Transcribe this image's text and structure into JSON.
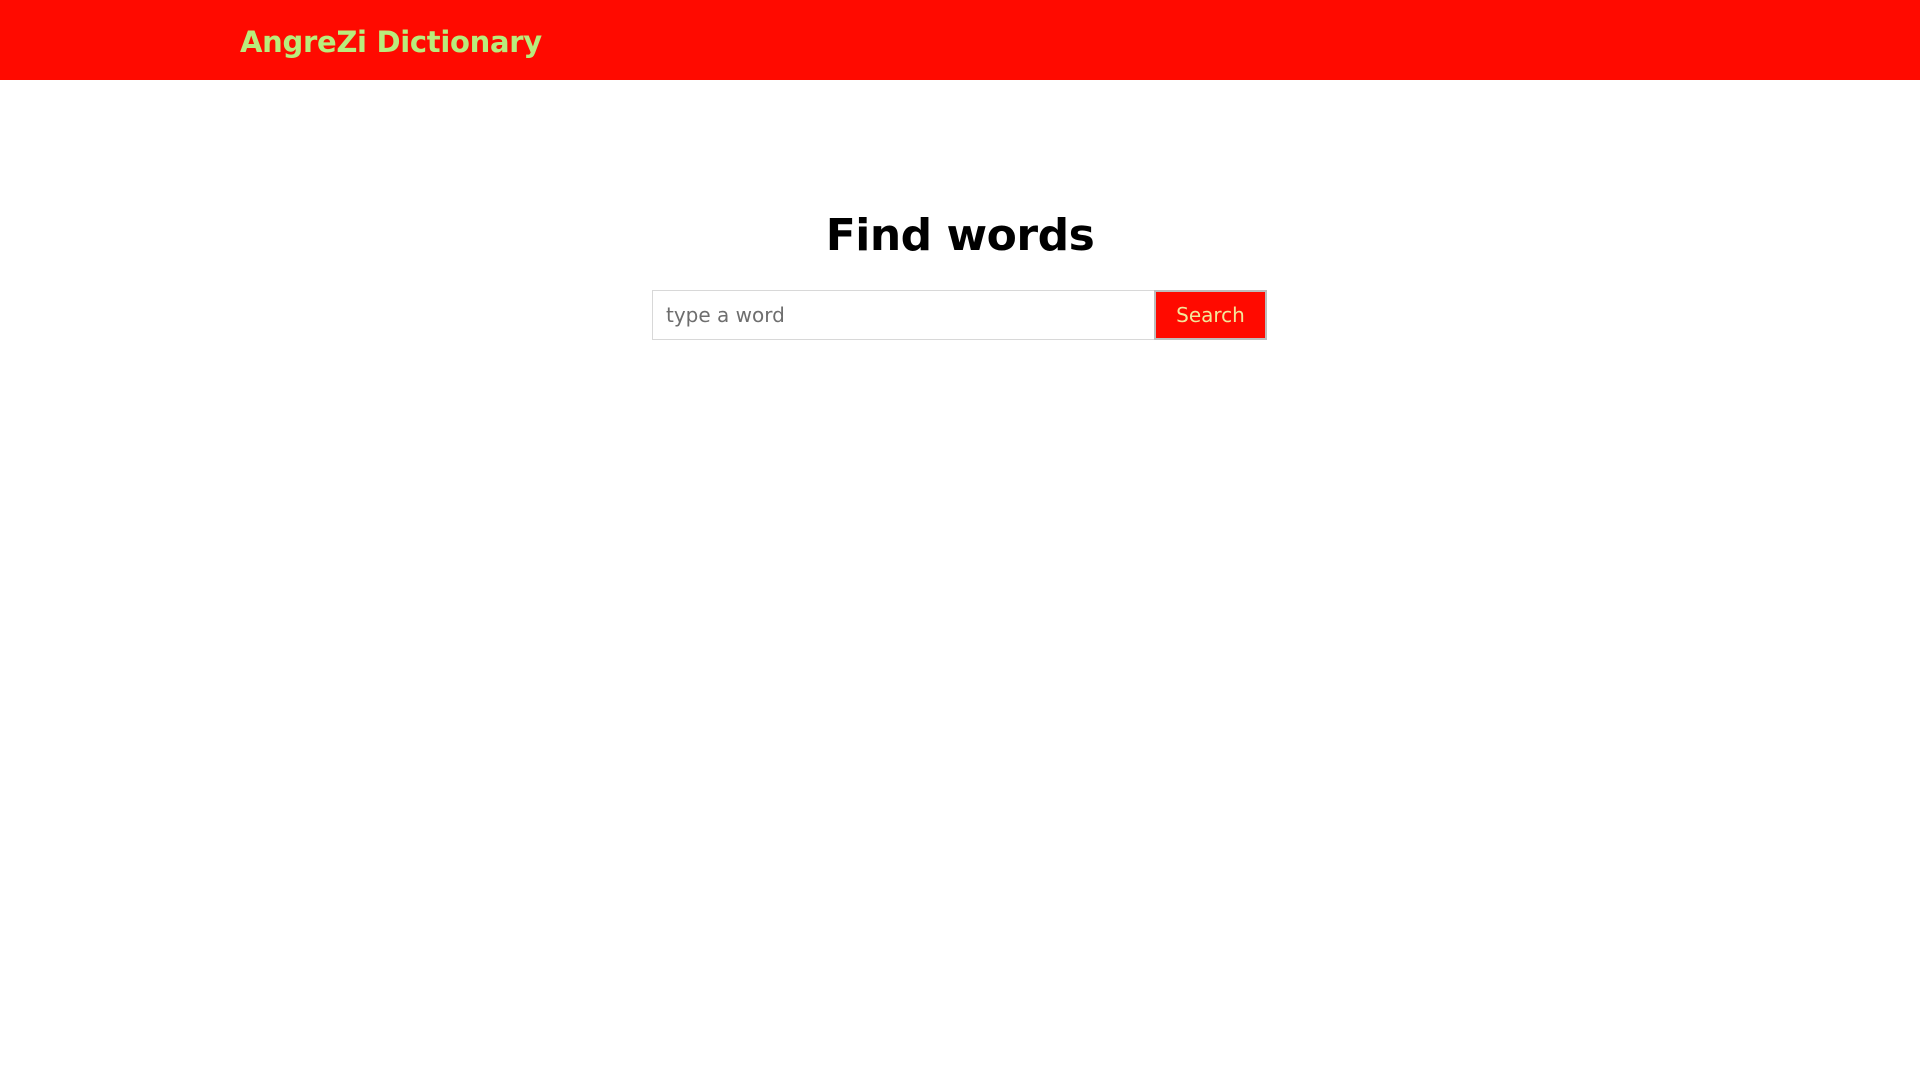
{
  "header": {
    "brand": "AngreZi Dictionary"
  },
  "main": {
    "title": "Find words",
    "search": {
      "placeholder": "type a word",
      "value": "",
      "button_label": "Search"
    }
  },
  "colors": {
    "header_bg": "#ff0a00",
    "brand_text": "#b9ec7c",
    "button_bg": "#ff0a00",
    "button_text": "#f3e79a"
  }
}
